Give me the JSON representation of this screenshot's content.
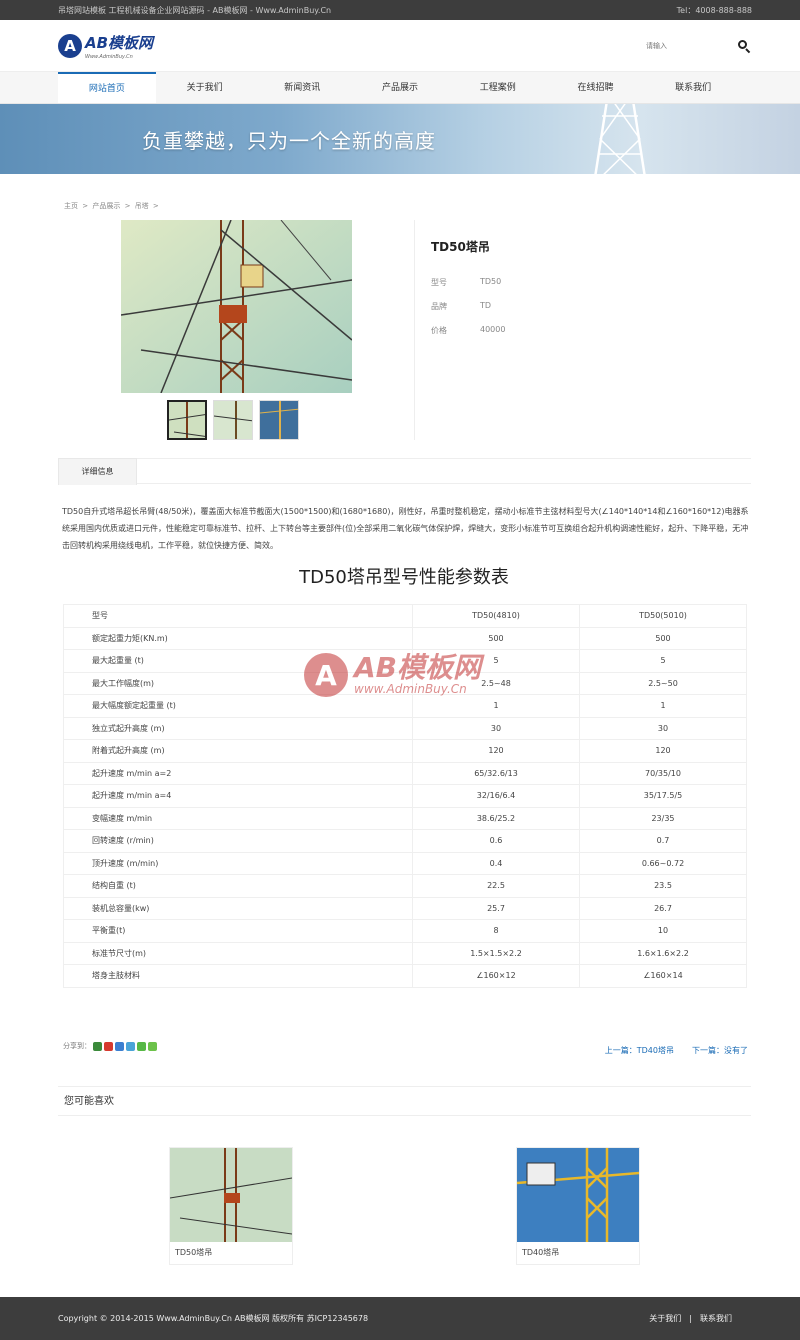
{
  "topbar": {
    "left": "吊塔网站模板 工程机械设备企业网站源码 - AB模板网 - Www.AdminBuy.Cn",
    "right": "Tel：4008-888-888"
  },
  "logo": {
    "mark": "A",
    "name": "AB模板网",
    "sub": "Www.AdminBuy.Cn"
  },
  "search": {
    "placeholder": "请输入"
  },
  "nav": [
    "网站首页",
    "关于我们",
    "新闻资讯",
    "产品展示",
    "工程案例",
    "在线招聘",
    "联系我们"
  ],
  "banner": {
    "slogan": "负重攀越，只为一个全新的高度"
  },
  "breadcrumb": [
    "主页",
    ">",
    "产品展示",
    ">",
    "吊塔",
    ">"
  ],
  "product": {
    "title": "TD50塔吊",
    "attrs": [
      {
        "key": "型号",
        "value": "TD50"
      },
      {
        "key": "品牌",
        "value": "TD"
      },
      {
        "key": "价格",
        "value": "40000"
      }
    ]
  },
  "tabs": {
    "detail": "详细信息"
  },
  "description": "TD50自升式塔吊超长吊臂(48/50米)，覆盖面大标准节截面大(1500*1500)和(1680*1680)，刚性好，吊重时整机稳定，摆动小标准节主弦材料型号大(∠140*140*14和∠160*160*12)电器系统采用国内优质或进口元件，性能稳定可靠标准节、拉杆、上下转台等主要部件(位)全部采用二氧化碳气体保护焊，焊缝大，变形小标准节可互换组合起升机构调速性能好，起升、下降平稳，无冲击回转机构采用绕线电机，工作平稳，就位快捷方便、简效。",
  "table_title": "TD50塔吊型号性能参数表",
  "spec_table": [
    [
      "型号",
      "TD50(4810)",
      "TD50(5010)"
    ],
    [
      "额定起重力矩(KN.m)",
      "500",
      "500"
    ],
    [
      "最大起重量 (t)",
      "5",
      "5"
    ],
    [
      "最大工作幅度(m)",
      "2.5~48",
      "2.5~50"
    ],
    [
      "最大幅度额定起重量 (t)",
      "1",
      "1"
    ],
    [
      "独立式起升高度 (m)",
      "30",
      "30"
    ],
    [
      "附着式起升高度 (m)",
      "120",
      "120"
    ],
    [
      " 起升速度 m/min   a=2",
      "65/32.6/13",
      "70/35/10"
    ],
    [
      "起升速度 m/min   a=4",
      "32/16/6.4",
      "35/17.5/5"
    ],
    [
      "变幅速度  m/min",
      "38.6/25.2",
      "23/35"
    ],
    [
      "回转速度 (r/min)",
      "0.6",
      "0.7"
    ],
    [
      "顶升速度 (m/min)",
      "0.4",
      "0.66~0.72"
    ],
    [
      "结构自重 (t)",
      "22.5",
      "23.5"
    ],
    [
      "装机总容量(kw)",
      "25.7",
      "26.7"
    ],
    [
      "平衡重(t)",
      "8",
      "10"
    ],
    [
      "标准节尺寸(m)",
      "1.5×1.5×2.2",
      "1.6×1.6×2.2"
    ],
    [
      "塔身主肢材料",
      "∠160×12",
      "∠160×14"
    ]
  ],
  "watermark": {
    "mark": "A",
    "name": "AB模板网",
    "url": "www.AdminBuy.Cn"
  },
  "share": {
    "label": "分享到："
  },
  "pager": {
    "prev": "上一篇：TD40塔吊",
    "next": "下一篇：没有了"
  },
  "related": {
    "heading": "您可能喜欢",
    "items": [
      {
        "title": "TD50塔吊"
      },
      {
        "title": "TD40塔吊"
      }
    ]
  },
  "footer": {
    "copyright": "Copyright © 2014-2015 Www.AdminBuy.Cn AB模板网 版权所有   苏ICP12345678",
    "links": [
      "关于我们",
      "|",
      "联系我们"
    ]
  },
  "colors": {
    "accent": "#1a6bb5",
    "brand": "#1a3f8f",
    "topbar": "#3d3d3d",
    "watermark": "#c23232"
  },
  "icons": [
    "search-icon",
    "share-icons"
  ]
}
